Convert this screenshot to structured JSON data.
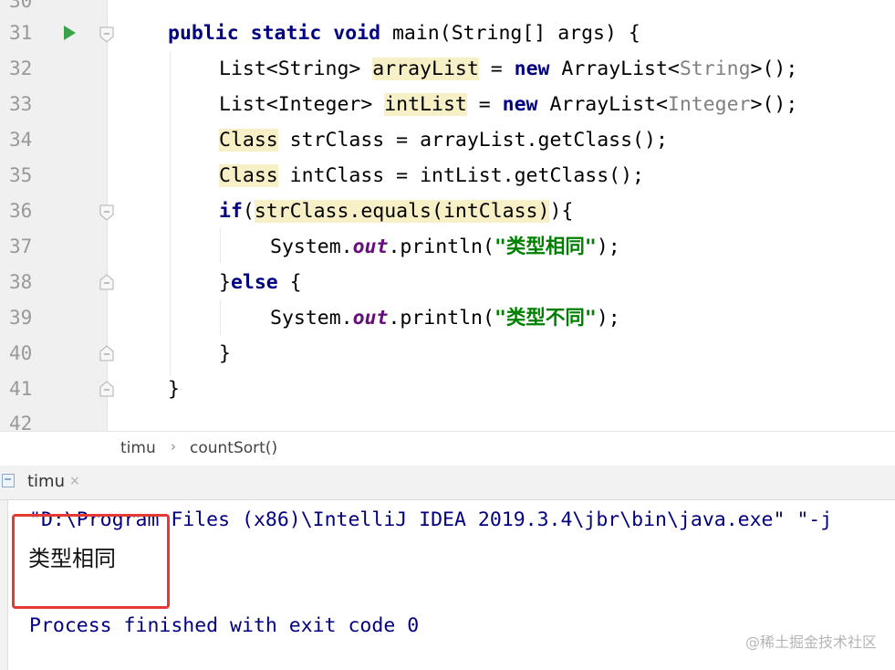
{
  "editor": {
    "top_partial_number": "30",
    "bottom_partial_number": "42",
    "lines": [
      {
        "num": "31",
        "parts": [
          {
            "t": "public",
            "c": "kw"
          },
          {
            "t": " ",
            "c": ""
          },
          {
            "t": "static",
            "c": "kw"
          },
          {
            "t": " ",
            "c": ""
          },
          {
            "t": "void",
            "c": "kw"
          },
          {
            "t": " main(String[] args) {",
            "c": ""
          }
        ]
      },
      {
        "num": "32",
        "parts": [
          {
            "t": "List<String> ",
            "c": ""
          },
          {
            "t": "arrayList",
            "c": "hl"
          },
          {
            "t": " = ",
            "c": ""
          },
          {
            "t": "new",
            "c": "kw"
          },
          {
            "t": " ArrayList<",
            "c": ""
          },
          {
            "t": "String",
            "c": "gen"
          },
          {
            "t": ">();",
            "c": ""
          }
        ]
      },
      {
        "num": "33",
        "parts": [
          {
            "t": "List<Integer> ",
            "c": ""
          },
          {
            "t": "intList",
            "c": "hl"
          },
          {
            "t": " = ",
            "c": ""
          },
          {
            "t": "new",
            "c": "kw"
          },
          {
            "t": " ArrayList<",
            "c": ""
          },
          {
            "t": "Integer",
            "c": "gen"
          },
          {
            "t": ">();",
            "c": ""
          }
        ]
      },
      {
        "num": "34",
        "parts": [
          {
            "t": "Class",
            "c": "hl"
          },
          {
            "t": " strClass = arrayList.getClass();",
            "c": ""
          }
        ]
      },
      {
        "num": "35",
        "parts": [
          {
            "t": "Class",
            "c": "hl"
          },
          {
            "t": " intClass = intList.getClass();",
            "c": ""
          }
        ]
      },
      {
        "num": "36",
        "parts": [
          {
            "t": "if",
            "c": "kw"
          },
          {
            "t": "(",
            "c": ""
          },
          {
            "t": "strClass.equals(intClass)",
            "c": "hl"
          },
          {
            "t": "){",
            "c": ""
          }
        ]
      },
      {
        "num": "37",
        "parts": [
          {
            "t": "System.",
            "c": ""
          },
          {
            "t": "out",
            "c": "fi"
          },
          {
            "t": ".println(",
            "c": ""
          },
          {
            "t": "\"类型相同\"",
            "c": "st"
          },
          {
            "t": ");",
            "c": ""
          }
        ]
      },
      {
        "num": "38",
        "parts": [
          {
            "t": "}",
            "c": ""
          },
          {
            "t": "else",
            "c": "kw"
          },
          {
            "t": " {",
            "c": ""
          }
        ]
      },
      {
        "num": "39",
        "parts": [
          {
            "t": "System.",
            "c": ""
          },
          {
            "t": "out",
            "c": "fi"
          },
          {
            "t": ".println(",
            "c": ""
          },
          {
            "t": "\"类型不同\"",
            "c": "st"
          },
          {
            "t": ");",
            "c": ""
          }
        ]
      },
      {
        "num": "40",
        "parts": [
          {
            "t": "}",
            "c": ""
          }
        ]
      },
      {
        "num": "41",
        "parts": [
          {
            "t": "}",
            "c": ""
          }
        ]
      }
    ]
  },
  "breadcrumb": {
    "items": [
      "timu",
      "countSort()"
    ],
    "separator": "›"
  },
  "run_panel": {
    "tab_label": "timu",
    "tab_close": "×",
    "command_line": "\"D:\\Program Files (x86)\\IntelliJ IDEA 2019.3.4\\jbr\\bin\\java.exe\" \"-j",
    "output": "类型相同",
    "process_line": "Process finished with exit code 0"
  },
  "watermark": "@稀土掘金技术社区"
}
